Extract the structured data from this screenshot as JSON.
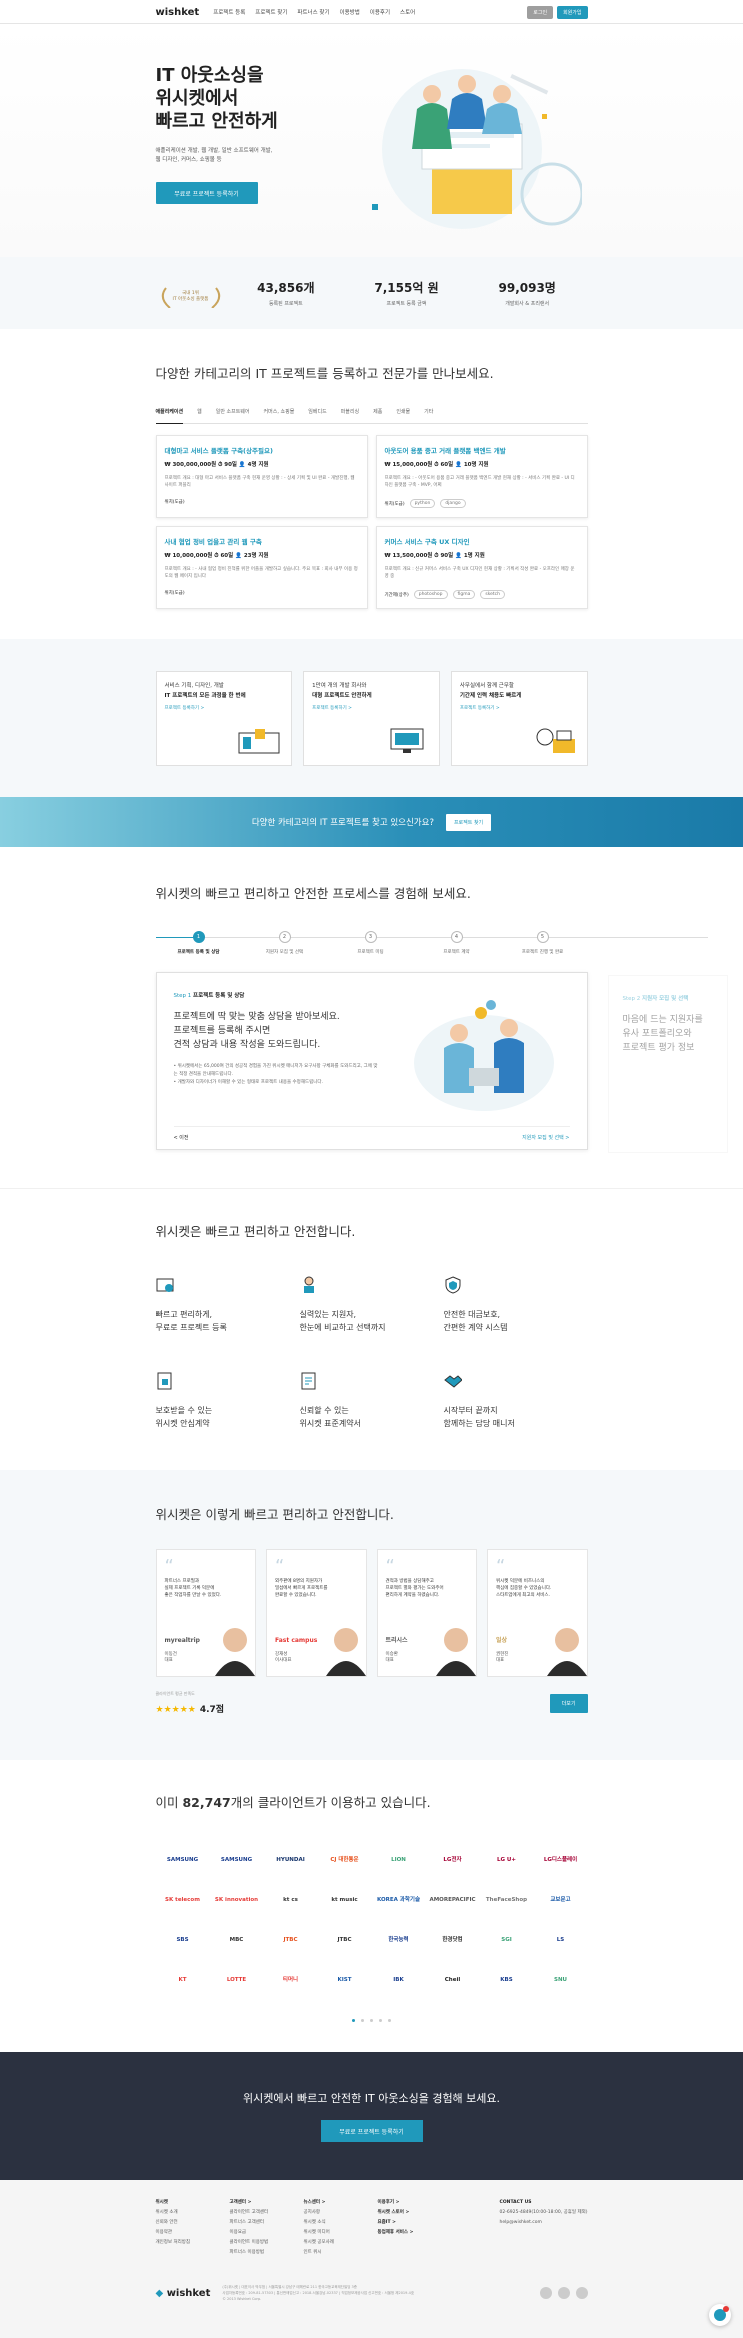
{
  "header": {
    "logo": "wishket",
    "nav": [
      "프로젝트 등록",
      "프로젝트 찾기",
      "파트너스 찾기",
      "이용방법",
      "이용후기",
      "스토어"
    ],
    "login": "로그인",
    "signup": "회원가입"
  },
  "hero": {
    "title": "IT 아웃소싱을\n위시켓에서\n빠르고 안전하게",
    "sub": "애플리케이션 개발, 웹 개발, 일반 소프트웨어 개발,\n웹 디자인, 커머스, 쇼핑몰 등",
    "cta": "무료로 프로젝트 등록하기"
  },
  "stats": {
    "badge": "국내 1위\nIT 아웃소싱 플랫폼",
    "items": [
      {
        "n": "43,856개",
        "l": "등록된 프로젝트"
      },
      {
        "n": "7,155억 원",
        "l": "프로젝트 등록 금액"
      },
      {
        "n": "99,093명",
        "l": "개발회사 & 프리랜서"
      }
    ]
  },
  "categories": {
    "title": "다양한 카테고리의 IT 프로젝트를 등록하고 전문가를 만나보세요.",
    "tabs": [
      "애플리케이션",
      "웹",
      "일반 소프트웨어",
      "커머스, 쇼핑몰",
      "임베디드",
      "퍼블리싱",
      "제품",
      "인쇄물",
      "기타"
    ],
    "cards": [
      {
        "t": "대형마고 서비스 플랫폼 구축(상주필요)",
        "m": "₩ 300,000,000원  ⏱ 90일  👤 4명 지원",
        "d": "프로젝트 개요 : 대형 마고 서비스 플랫폼 구축 현재 운영 상황 : - 상세 기획 및 UI 완료 - 개발진행, 웹사이트 퍼블리",
        "f": "위치(도급)",
        "tags": []
      },
      {
        "t": "아웃도어 용품 중고 거래 플랫폼 백엔드 개발",
        "m": "₩ 15,000,000원  ⏱ 60일  👤 10명 지원",
        "d": "프로젝트 개요 : - 아웃도어 용품 중고 거래 플랫폼 백엔드 개발 현재 상황 : - 서비스 기획 완료 - UI 디자인 플랫폼 구축 - MVP, 어쩌",
        "f": "위치(도급)",
        "tags": [
          "python",
          "django"
        ]
      },
      {
        "t": "사내 협업 정비 업을고 관리 웹 구축",
        "m": "₩ 10,000,000원  ⏱ 60일  👤 23명 지원",
        "d": "프로젝트 개요 : - 사내 협업 정비 진척률 위한 어플을 개발하고 싶습니다. 주요 목표 : 회사 내부 이용 정도의 웹 페이지 입니다",
        "f": "위치(도급)",
        "tags": []
      },
      {
        "t": "커머스 서비스 구축 UX 디자인",
        "m": "₩ 13,500,000원  ⏱ 90일  👤 1명 지원",
        "d": "프로젝트 개요 : 신규 커머스 서비스 구축 UX 디자인 현재 상황 : 기획서 작성 완료 - 오프라인 매장 운영 중",
        "f": "기간제(상주)",
        "tags": [
          "photoshop",
          "figma",
          "sketch"
        ]
      }
    ]
  },
  "services": [
    {
      "a": "서비스 기획, 디자인, 개발",
      "b": "IT 프로젝트의 모든 과정을 한 번에",
      "c": "프로젝트 등록하기 >"
    },
    {
      "a": "1만여 개의 개발 회사와",
      "b": "대형 프로젝트도 안전하게",
      "c": "프로젝트 등록하기 >"
    },
    {
      "a": "사무실에서 함께 근무할",
      "b": "기간제 인력 채용도 빠르게",
      "c": "프로젝트 등록하기 >"
    }
  ],
  "banner": {
    "text": "다양한 카테고리의 IT 프로젝트를 찾고 있으신가요?",
    "btn": "프로젝트 찾기"
  },
  "process": {
    "title": "위시켓의 빠르고 편리하고 안전한 프로세스를 경험해 보세요.",
    "steps": [
      "프로젝트 등록 및 상담",
      "지원자 모집 및 선택",
      "프로젝트 미팅",
      "프로젝트 계약",
      "프로젝트 진행 및 완료"
    ],
    "stepNo": "Step 1",
    "stepTitle": "프로젝트 등록 및 상담",
    "big": "프로젝트에 딱 맞는 맞춤 상담을 받아보세요.\n프로젝트를 등록해 주시면\n견적 상담과 내용 작성을 도와드립니다.",
    "bullets": [
      "위시켓에서는 65,000여 건의 성공적 경험을 가진 위시켓 매니저가 요구사항 구체화를 도와드리고, 그에 맞는 적정 견적을 안내해드립니다.",
      "개발자와 디자이너가 이해할 수 있는 형태로 프로젝트 내용을 수정해드립니다."
    ],
    "prev": "< 이전",
    "next": "지원자 모집 및 선택 >",
    "ghostNo": "Step 2",
    "ghostTitle": "지원자 모집 및 선택",
    "ghostBig": "마음에 드는 지원자를\n유사 포트폴리오와\n프로젝트 평가 정보"
  },
  "safety": {
    "title": "위시켓은 빠르고 편리하고 안전합니다.",
    "items": [
      "빠르고 편리하게,\n무료로 프로젝트 등록",
      "실력있는 지원자,\n한눈에 비교하고 선택까지",
      "안전한 대금보호,\n간편한 계약 시스템",
      "보호받을 수 있는\n위시켓 안심계약",
      "신뢰할 수 있는\n위시켓 표준계약서",
      "시작부터 끝까지\n함께하는 담당 매니저"
    ]
  },
  "reviews": {
    "title": "위시켓은 이렇게 빠르고 편리하고 안전합니다.",
    "cards": [
      {
        "rt": "파트너스 프로필과\n실제 프로젝트 기록 덕분에\n좋은 작업자를 만날 수 있었다.",
        "co": "myrealtrip",
        "nm": "이동건\n대표"
      },
      {
        "rt": "외주판에 8명의 지원자가\n밀섭에서 빠르게 프로젝트를\n완료할 수 있었습니다.",
        "co": "Fast campus",
        "nm": "강재성\n이사대표"
      },
      {
        "rt": "견적과 방법을 상담해주고\n프로젝트 별와 평가는 도와주어\n편리하게 계약을 하였습니다.",
        "co": "트리시스",
        "nm": "이승환\n대표"
      },
      {
        "rt": "위시켓 덕분에 비즈니스의\n핵심에 집중할 수 있었습니다.\n스타트업에게 최고의 서비스.",
        "co": "일상",
        "nm": "권현진\n대표"
      }
    ],
    "label": "클라이언트 평균 만족도",
    "stars": "★★★★★",
    "score": "4.7점",
    "btn": "더보기"
  },
  "clients": {
    "title_pre": "이미 ",
    "count": "82,747",
    "title_post": "개의 클라이언트가 이용하고 있습니다.",
    "logos": [
      "SAMSUNG",
      "SAMSUNG",
      "HYUNDAI",
      "CJ 대한통운",
      "LION",
      "LG전자",
      "LG U+",
      "LG디스플레이",
      "SK telecom",
      "SK innovation",
      "kt cs",
      "kt music",
      "KOREA 과학기술",
      "AMOREPACIFIC",
      "TheFaceShop",
      "교보문고",
      "SBS",
      "MBC",
      "JTBC",
      "JTBC",
      "한국능력",
      "한경닷컴",
      "SGI",
      "LS",
      "KT",
      "LOTTE",
      "티머니",
      "KIST",
      "IBK",
      "Cheil",
      "KBS",
      "SNU"
    ]
  },
  "ctaFoot": {
    "title": "위시켓에서 빠르고 안전한 IT 아웃소싱을 경험해 보세요.",
    "btn": "무료로 프로젝트 등록하기"
  },
  "footer": {
    "cols": [
      {
        "h": "위시켓",
        "items": [
          "위시켓 소개",
          "신뢰와 안전",
          "이용약관",
          "개인정보 처리방침"
        ]
      },
      {
        "h": "고객센터 >",
        "items": [
          "클라이언트 고객센터",
          "파트너스 고객센터",
          "이용요금",
          "클라이언트 이용방법",
          "파트너스 이용방법"
        ]
      },
      {
        "h": "뉴스센터 >",
        "items": [
          "공지사항",
          "위시켓 소식",
          "위시켓 미디어",
          "위시켓 공모사례",
          "인트 위시"
        ]
      },
      {
        "h": "이용후기 >",
        "items": [
          "위시켓 스토어 >",
          "요즘IT >",
          "동업제휴 서비스 >"
        ]
      }
    ],
    "contact": "CONTACT US",
    "phone": "02-6925-4849(10:00-18:00, 공휴일 제외)",
    "mail": "help@wishket.com",
    "logo": "wishket",
    "info": "(주)위시켓 | 대표이사 박우범 | 서울특별시 강남구 테헤란로 211 한국고등교육재단빌딩 3층\n사업자등록번호 : 209-81-57303 | 통신판매업신고 : 2018-서울강남-02337 | 직업정보제공사업 신고번호 : 서울청 제2019-4호\n© 2013 Wishket Corp."
  }
}
